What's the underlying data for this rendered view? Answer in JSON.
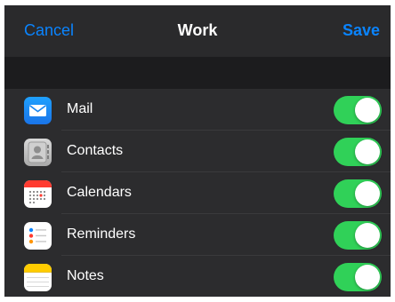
{
  "header": {
    "cancel_label": "Cancel",
    "title": "Work",
    "save_label": "Save"
  },
  "accounts": [
    {
      "label": "Mail",
      "icon": "mail-icon",
      "enabled": true
    },
    {
      "label": "Contacts",
      "icon": "contacts-icon",
      "enabled": true
    },
    {
      "label": "Calendars",
      "icon": "calendar-icon",
      "enabled": true
    },
    {
      "label": "Reminders",
      "icon": "reminders-icon",
      "enabled": true
    },
    {
      "label": "Notes",
      "icon": "notes-icon",
      "enabled": true
    }
  ],
  "colors": {
    "accent": "#0a84ff",
    "toggle_on": "#30d158",
    "background": "#1c1c1e",
    "row_background": "#2c2c2e"
  }
}
